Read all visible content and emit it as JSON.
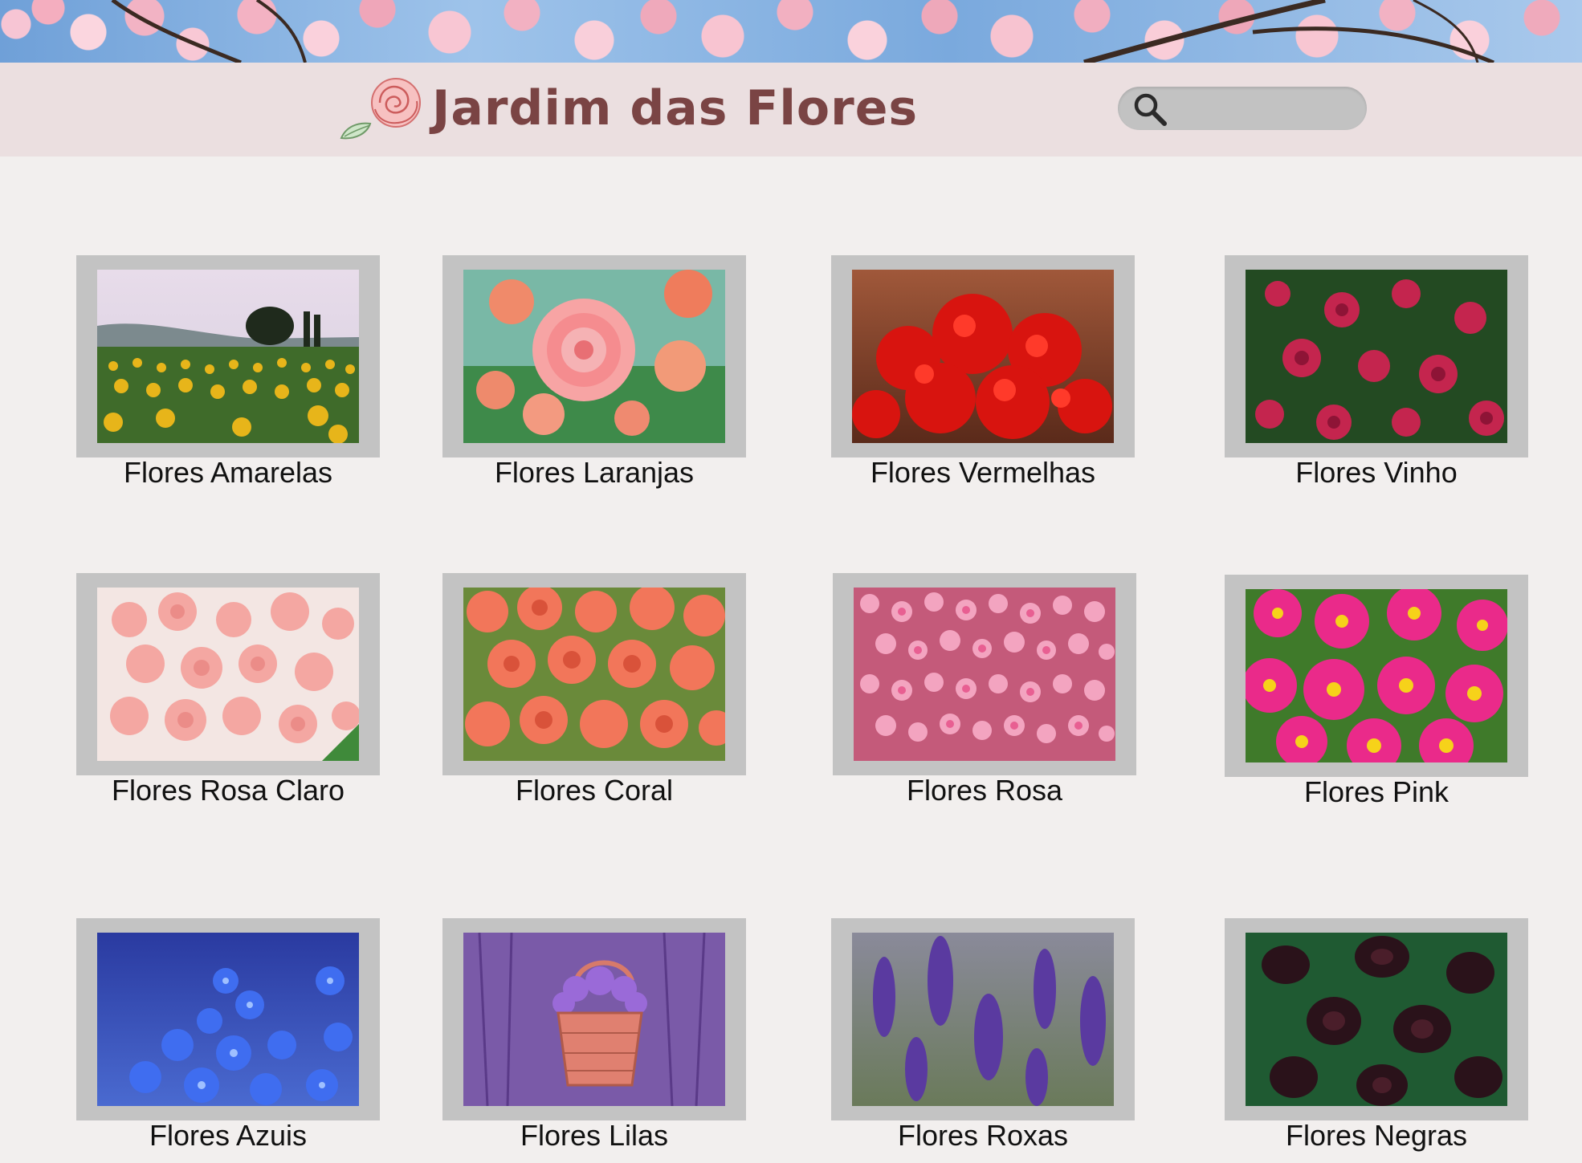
{
  "site": {
    "title": "Jardim das Flores",
    "logo_icon": "rose-icon"
  },
  "search": {
    "placeholder": "",
    "value": "",
    "icon": "search-icon"
  },
  "categories": [
    {
      "label": "Flores Amarelas",
      "image": "sunflower-field"
    },
    {
      "label": "Flores Laranjas",
      "image": "orange-begonia"
    },
    {
      "label": "Flores Vermelhas",
      "image": "red-flowers"
    },
    {
      "label": "Flores Vinho",
      "image": "wine-dahlias"
    },
    {
      "label": "Flores Rosa Claro",
      "image": "light-pink-roses"
    },
    {
      "label": "Flores Coral",
      "image": "coral-roses"
    },
    {
      "label": "Flores Rosa",
      "image": "pink-roses"
    },
    {
      "label": "Flores Pink",
      "image": "pink-daisies"
    },
    {
      "label": "Flores Azuis",
      "image": "blue-flowers"
    },
    {
      "label": "Flores Lilas",
      "image": "lavender-basket"
    },
    {
      "label": "Flores Roxas",
      "image": "purple-lavender"
    },
    {
      "label": "Flores Negras",
      "image": "black-callas"
    }
  ],
  "colors": {
    "page_background": "#f2efee",
    "header_background": "#ebdfe0",
    "title_color": "#7a4444",
    "frame_color": "#c3c3c3",
    "search_color": "#c2c2c2"
  }
}
